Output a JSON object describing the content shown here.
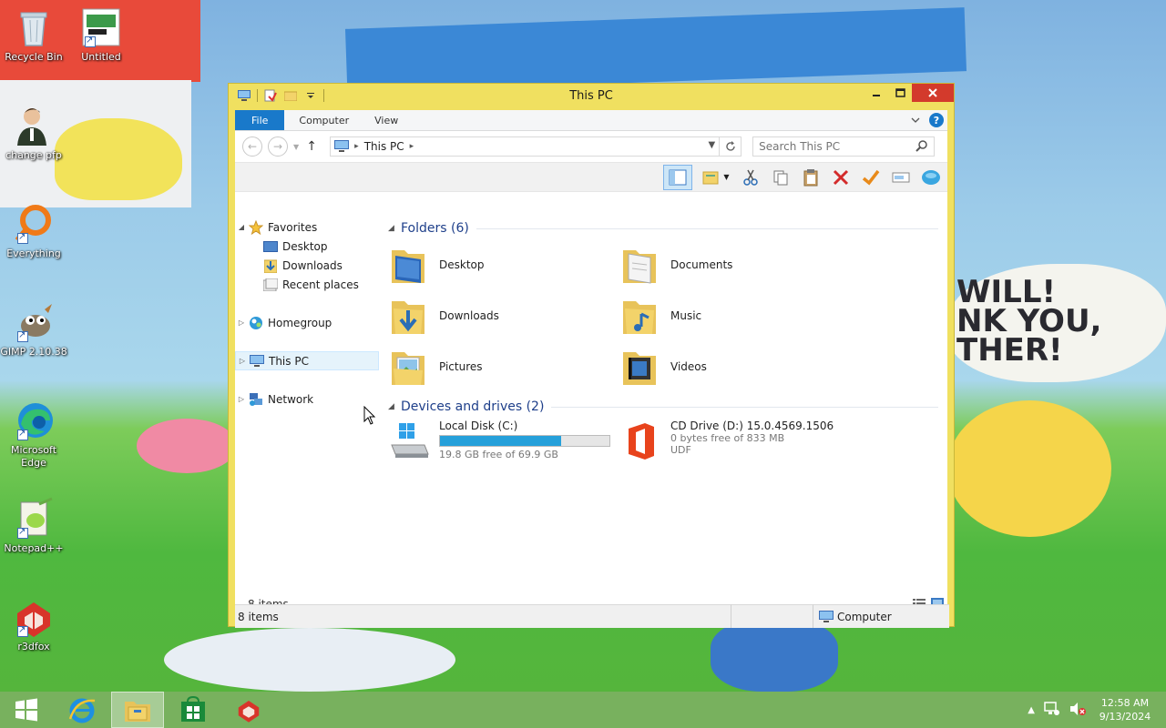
{
  "desktop": {
    "icons": [
      {
        "label": "Recycle Bin",
        "icon": "recycle-bin-icon"
      },
      {
        "label": "Untitled",
        "icon": "image-file-icon"
      },
      {
        "label": "change pfp",
        "icon": "user-icon"
      },
      {
        "label": "Everything",
        "icon": "everything-search-icon"
      },
      {
        "label": "GIMP 2.10.38",
        "icon": "gimp-icon"
      },
      {
        "label": "Microsoft Edge",
        "icon": "edge-icon"
      },
      {
        "label": "Notepad++",
        "icon": "notepadpp-icon"
      },
      {
        "label": "r3dfox",
        "icon": "r3dfox-icon"
      }
    ],
    "wallpaper_text": "WILL!\nNK YOU,\nTHER!"
  },
  "window": {
    "title": "This PC",
    "tabs": [
      {
        "label": "File"
      },
      {
        "label": "Computer"
      },
      {
        "label": "View"
      }
    ],
    "address": {
      "crumb": "This PC"
    },
    "search": {
      "placeholder": "Search This PC"
    },
    "nav": {
      "favorites": "Favorites",
      "favorites_items": [
        "Desktop",
        "Downloads",
        "Recent places"
      ],
      "homegroup": "Homegroup",
      "this_pc": "This PC",
      "network": "Network"
    },
    "folders_header": "Folders (6)",
    "folders": [
      {
        "name": "Desktop",
        "icon": "desktop-folder-icon"
      },
      {
        "name": "Documents",
        "icon": "documents-folder-icon"
      },
      {
        "name": "Downloads",
        "icon": "downloads-folder-icon"
      },
      {
        "name": "Music",
        "icon": "music-folder-icon"
      },
      {
        "name": "Pictures",
        "icon": "pictures-folder-icon"
      },
      {
        "name": "Videos",
        "icon": "videos-folder-icon"
      }
    ],
    "drives_header": "Devices and drives (2)",
    "drives": [
      {
        "name": "Local Disk (C:)",
        "free": "19.8 GB free of 69.9 GB",
        "used_fraction": 0.717,
        "icon": "hard-disk-icon"
      },
      {
        "name": "CD Drive (D:) 15.0.4569.1506",
        "free": "0 bytes free of 833 MB",
        "fs": "UDF",
        "icon": "office-icon"
      }
    ],
    "item_count": "8 items",
    "status": {
      "items": "8 items",
      "location": "Computer"
    }
  },
  "taskbar": {
    "items": [
      "start-icon",
      "internet-explorer-icon",
      "file-explorer-icon",
      "store-icon",
      "r3dfox-icon"
    ],
    "time": "12:58 AM",
    "date": "9/13/2024"
  },
  "colors": {
    "window_frame": "#f0e060",
    "close": "#d33a2c",
    "accent": "#1979ca",
    "drive_bar": "#26a0da",
    "taskbar": "#6caa50"
  }
}
